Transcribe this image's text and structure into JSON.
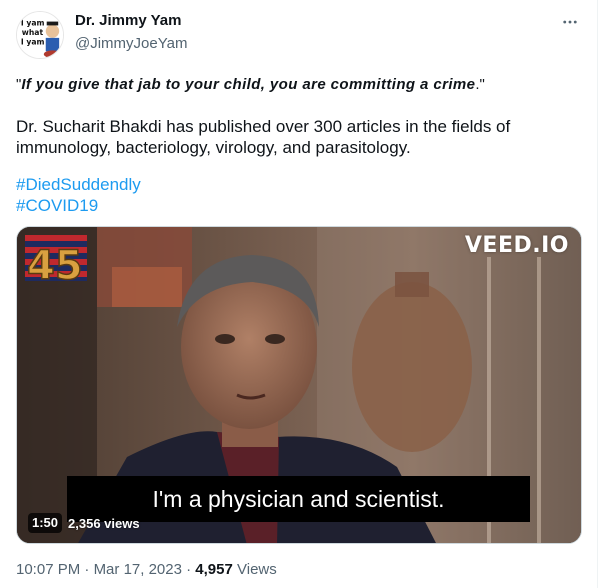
{
  "author": {
    "name": "Dr. Jimmy Yam",
    "handle": "@JimmyJoeYam",
    "avatar_text": [
      "I yam",
      "what",
      "I yam"
    ]
  },
  "tweet": {
    "quote_open": "\"",
    "quote_text": "If you give that jab to your child, you are committing a crime",
    "quote_close": ".\"",
    "paragraph": "Dr. Sucharit Bhakdi has published over 300 articles in the fields of immunology, bacteriology, virology, and parasitology.",
    "hashtags": [
      "#DiedSuddendly",
      "#COVID19"
    ]
  },
  "video": {
    "watermark": "VEED.IO",
    "subtitle": "I'm a physician and scientist.",
    "duration": "1:50",
    "views": "2,356 views",
    "logo_number": "45"
  },
  "footer": {
    "time": "10:07 PM",
    "date": "Mar 17, 2023",
    "view_count": "4,957",
    "views_label": "Views",
    "separator": "·"
  },
  "icons": {
    "more": "more-horizontal-icon"
  },
  "colors": {
    "link": "#1d9bf0",
    "secondary_text": "#536471",
    "primary_text": "#0f1419"
  }
}
